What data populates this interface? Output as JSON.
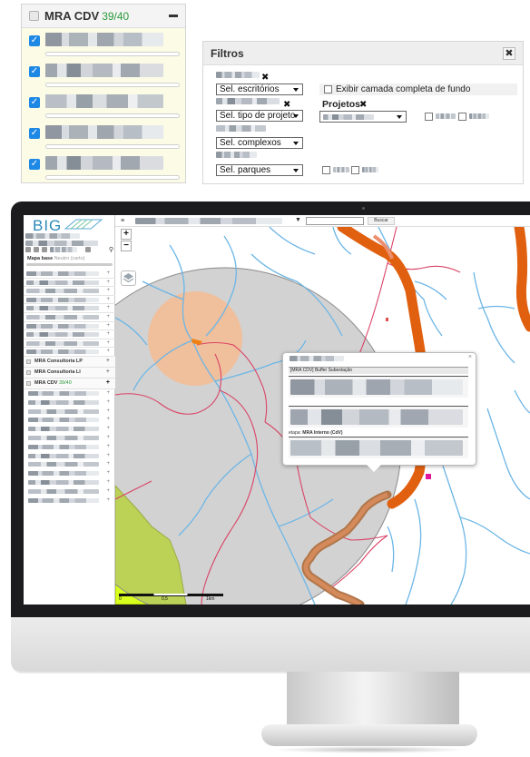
{
  "layers_panel": {
    "title": "MRA CDV",
    "count": "39/40",
    "rows": 5
  },
  "filters_panel": {
    "title": "Filtros",
    "close_glyph": "✖",
    "select_escritorios": "Sel. escritórios",
    "select_tipo_projeto": "Sel. tipo de projeto",
    "select_complexos": "Sel. complexos",
    "select_parques": "Sel. parques",
    "exibir_camada": "Exibir camada completa de fundo",
    "projetos_label": "Projetos",
    "remove_glyph": "✖"
  },
  "sidebar": {
    "logo": "BIG",
    "mapa_base_label": "Mapa base",
    "mapa_base_sub": "Neutro (carto)",
    "groups": [
      {
        "title": "MRA Consultoria LP",
        "count": ""
      },
      {
        "title": "MRA Consultoria LI",
        "count": ""
      },
      {
        "title": "MRA CDV",
        "count": "39/40"
      }
    ]
  },
  "topbar": {
    "menu_glyph": "≡",
    "filter_glyph": "▼",
    "search_button": "Buscar"
  },
  "map": {
    "zoom_in": "+",
    "zoom_out": "−",
    "scale_labels": [
      "0",
      "0,5",
      "1km"
    ],
    "popup": {
      "close": "×",
      "title": "[MRA CDV] Buffer Subestação",
      "etapa_label": "etapa:",
      "etapa_value": "MRA Interno (CdV)"
    }
  }
}
